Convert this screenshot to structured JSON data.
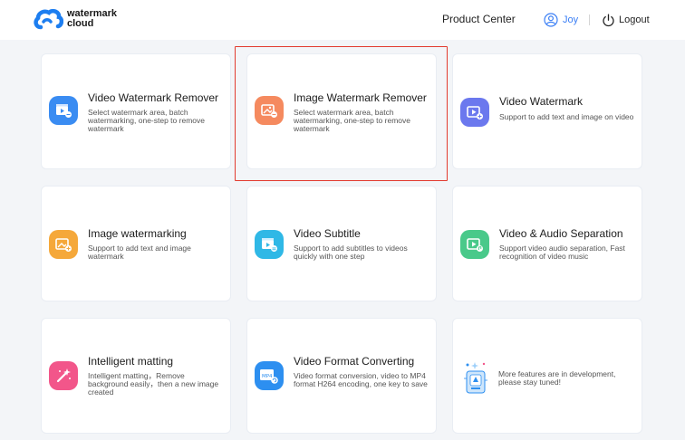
{
  "header": {
    "logo_line1": "watermark",
    "logo_line2": "cloud",
    "product_center": "Product Center",
    "user": "Joy",
    "logout": "Logout"
  },
  "cards": [
    {
      "title": "Video Watermark Remover",
      "desc": "Select watermark area, batch watermarking, one-step to remove watermark",
      "icon": "video-remove-icon",
      "color": "#3a8cf2"
    },
    {
      "title": "Image Watermark Remover",
      "desc": "Select watermark area, batch watermarking, one-step to remove watermark",
      "icon": "image-remove-icon",
      "color": "#f58a5f"
    },
    {
      "title": "Video Watermark",
      "desc": "Support to add text and image on video",
      "icon": "video-watermark-icon",
      "color": "#6b78ee"
    },
    {
      "title": "Image watermarking",
      "desc": "Support to add text and image watermark",
      "icon": "image-watermark-icon",
      "color": "#f5a83a"
    },
    {
      "title": "Video Subtitle",
      "desc": "Support to add subtitles to videos quickly with one step",
      "icon": "video-subtitle-icon",
      "color": "#2fb8e6"
    },
    {
      "title": "Video & Audio Separation",
      "desc": "Support video audio separation, Fast recognition of video music",
      "icon": "audio-separation-icon",
      "color": "#49c98a"
    },
    {
      "title": "Intelligent matting",
      "desc": "Intelligent matting，Remove background easily，then a new image created",
      "icon": "magic-wand-icon",
      "color": "#f2568a"
    },
    {
      "title": "Video Format Converting",
      "desc": "Video format conversion, video to MP4 format H264 encoding, one key to save",
      "icon": "mp4-convert-icon",
      "color": "#2d8ff0"
    }
  ],
  "more_features": "More features are in development, please stay tuned!",
  "mp4_label": "MP4"
}
